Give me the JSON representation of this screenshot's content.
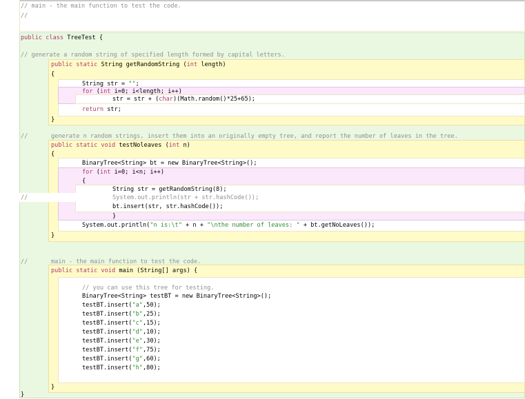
{
  "code": {
    "top_comment": [
      "// main - the main function to test the code.",
      "//"
    ],
    "class_decl": {
      "kw": "public class",
      "rest": " TreeTest {"
    },
    "getRandomString": {
      "comment": "// generate a random string of specified length formed by capital letters.",
      "signature": {
        "kw1": "public static",
        "mid": " String getRandomString (",
        "kw2": "int",
        "rest": " length)"
      },
      "open_brace": "{",
      "line_str": {
        "pre": "String str = ",
        "lit": "\"\"",
        "post": ";"
      },
      "line_for": {
        "kw1": "for",
        "a": " (",
        "kw2": "int",
        "b": " i=0; i<length; i++)"
      },
      "line_body": {
        "pre": "str = str + (",
        "kw": "char",
        "post": ")(Math.random()*25+65);"
      },
      "line_return": {
        "kw": "return",
        "post": " str;"
      },
      "close_brace": "}"
    },
    "testNoLeaves": {
      "comment_slashes": "//",
      "comment": "generate n random strings, insert them into an originally empty tree, and report the number of leaves in the tree.",
      "signature": {
        "kw1": "public static void",
        "mid": " testNoleaves (",
        "kw2": "int",
        "rest": " n)"
      },
      "open_brace": "{",
      "line_bt": "BinaryTree<String> bt = new BinaryTree<String>();",
      "line_for": {
        "kw1": "for",
        "a": " (",
        "kw2": "int",
        "b": " i=0; i<n; i++)"
      },
      "for_open": "{",
      "line_getstr": "String str = getRandomString(8);",
      "commented_slashes": "//",
      "commented_line": "System.out.println(str + str.hashCode());",
      "line_insert": "bt.insert(str, str.hashCode());",
      "for_close": "}",
      "line_print": {
        "pre": "System.out.println(",
        "lit1": "\"n is:\\t\"",
        "mid": " + n + ",
        "lit2": "\"\\nthe number of leaves: \"",
        "post": " + bt.getNoLeaves());"
      },
      "close_brace": "}"
    },
    "main": {
      "comment_slashes": "//",
      "comment": "main - the main function to test the code.",
      "signature": {
        "kw1": "public static void",
        "rest": " main (String[] args) {"
      },
      "comment2": "// you can use this tree for testing.",
      "line_bt": "BinaryTree<String> testBT = new BinaryTree<String>();",
      "inserts": [
        {
          "pre": "testBT.insert(",
          "lit": "\"a\"",
          "post": ",50);"
        },
        {
          "pre": "testBT.insert(",
          "lit": "\"b\"",
          "post": ",25);"
        },
        {
          "pre": "testBT.insert(",
          "lit": "\"c\"",
          "post": ",15);"
        },
        {
          "pre": "testBT.insert(",
          "lit": "\"d\"",
          "post": ",10);"
        },
        {
          "pre": "testBT.insert(",
          "lit": "\"e\"",
          "post": ",30);"
        },
        {
          "pre": "testBT.insert(",
          "lit": "\"f\"",
          "post": ",75);"
        },
        {
          "pre": "testBT.insert(",
          "lit": "\"g\"",
          "post": ",60);"
        },
        {
          "pre": "testBT.insert(",
          "lit": "\"h\"",
          "post": ",80);"
        }
      ],
      "close_brace": "}"
    },
    "class_close": "}"
  }
}
